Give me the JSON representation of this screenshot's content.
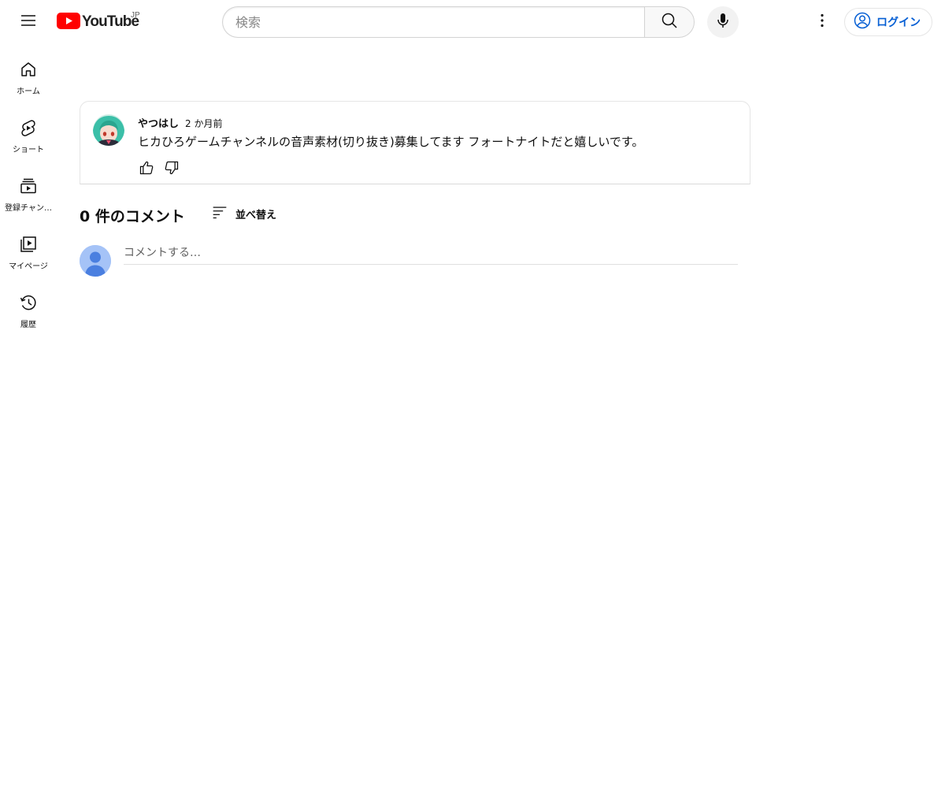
{
  "masthead": {
    "logo_text": "YouTube",
    "country_code": "JP",
    "search_placeholder": "検索",
    "login_label": "ログイン",
    "icons": {
      "menu": "hamburger-menu-icon",
      "search": "search-icon",
      "voice": "microphone-icon",
      "more": "more-vertical-icon",
      "account": "account-circle-icon"
    }
  },
  "guide": {
    "items": [
      {
        "label": "ホーム",
        "icon": "home-icon"
      },
      {
        "label": "ショート",
        "icon": "shorts-icon"
      },
      {
        "label": "登録チャン…",
        "icon": "subscriptions-icon"
      },
      {
        "label": "マイページ",
        "icon": "library-icon"
      },
      {
        "label": "履歴",
        "icon": "history-icon"
      }
    ]
  },
  "post": {
    "author": "やつはし",
    "time": "2 か月前",
    "text": "ヒカひろゲームチャンネルの音声素材(切り抜き)募集してます フォートナイトだと嬉しいです。",
    "icons": {
      "like": "thumb-up-icon",
      "dislike": "thumb-down-icon"
    }
  },
  "comments": {
    "count_label": "0 件のコメント",
    "sort_label": "並べ替え",
    "input_placeholder": "コメントする…"
  },
  "colors": {
    "brand_red": "#ff0000",
    "link_blue": "#065fd4",
    "text": "#0f0f0f",
    "secondary_text": "#606060"
  }
}
